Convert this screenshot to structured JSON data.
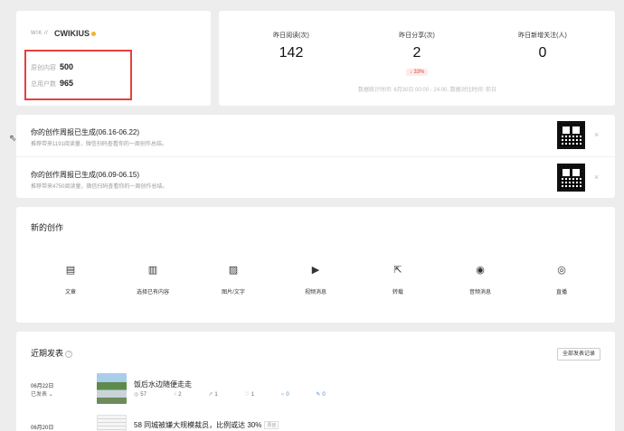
{
  "account": {
    "logo_text": "WIK //",
    "name": "CWIKIUS",
    "stats": [
      {
        "label": "原创内容",
        "value": "500"
      },
      {
        "label": "总用户数",
        "value": "965"
      }
    ]
  },
  "overview": {
    "items": [
      {
        "label": "昨日阅读(次)",
        "value": "142",
        "badge": ""
      },
      {
        "label": "昨日分享(次)",
        "value": "2",
        "badge": "↓ 33%"
      },
      {
        "label": "昨日新增关注(人)",
        "value": "0",
        "badge": ""
      }
    ],
    "note": "数据统计时间: 6月30日 00:00 - 24:00, 数据对比时间: 前日"
  },
  "reports": [
    {
      "title": "你的创作周报已生成(06.16-06.22)",
      "subtitle": "推荐带来1191阅读量，微信扫码查看你的一周创作总结。",
      "close": "×"
    },
    {
      "title": "你的创作周报已生成(06.09-06.15)",
      "subtitle": "推荐带来4750阅读量，微信扫码查看你的一周创作总结。",
      "close": "×"
    }
  ],
  "create": {
    "title": "新的创作",
    "tools": [
      {
        "label": "文章",
        "icon": "document-icon",
        "glyph": "▤"
      },
      {
        "label": "选择已有内容",
        "icon": "select-content-icon",
        "glyph": "▥"
      },
      {
        "label": "图片/文字",
        "icon": "image-icon",
        "glyph": "▨"
      },
      {
        "label": "视频消息",
        "icon": "video-icon",
        "glyph": "▶"
      },
      {
        "label": "转载",
        "icon": "repost-icon",
        "glyph": "⇱"
      },
      {
        "label": "音频消息",
        "icon": "audio-icon",
        "glyph": "◉"
      },
      {
        "label": "直播",
        "icon": "live-icon",
        "glyph": "◎"
      }
    ]
  },
  "recent": {
    "title": "近期发表",
    "help": "?",
    "all_button": "全部发表记录",
    "posts": [
      {
        "date": "06月22日",
        "status": "已发表 ⌄",
        "title": "饭后水边随便走走",
        "tag": "",
        "metrics": {
          "views": "57",
          "likes": "2",
          "shares": "1",
          "hearts": "1",
          "comments": "0",
          "edits": "0"
        }
      },
      {
        "date": "06月20日",
        "status": "",
        "title": "58 同城被嫌大规模裁员，比例或达 30%",
        "tag": "原创",
        "metrics": {
          "views": "",
          "likes": "",
          "shares": "",
          "hearts": "",
          "comments": "",
          "edits": ""
        }
      }
    ]
  }
}
